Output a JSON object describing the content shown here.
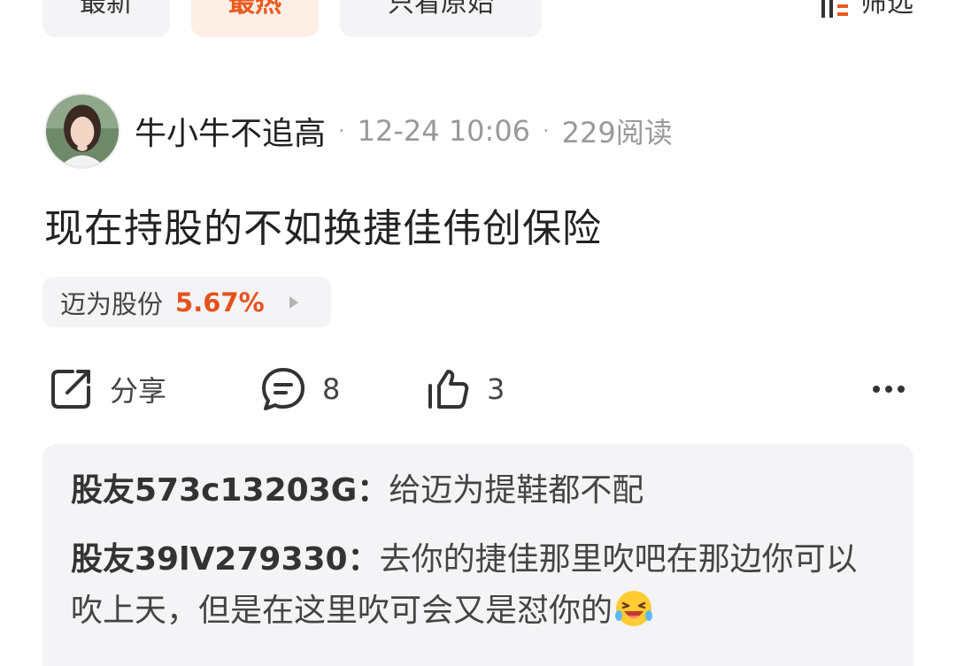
{
  "tabs": {
    "latest": "最新",
    "hot": "最热",
    "original_only": "只看原始",
    "filter": "筛选"
  },
  "post": {
    "author": "牛小牛不追高",
    "time": "12-24 10:06",
    "views": "229阅读",
    "content": "现在持股的不如换捷佳伟创保险",
    "stock": {
      "name": "迈为股份",
      "change": "5.67%"
    }
  },
  "actions": {
    "share_label": "分享",
    "comment_count": "8",
    "like_count": "3"
  },
  "comments": [
    {
      "user": "股友573c13203G",
      "text": "给迈为提鞋都不配"
    },
    {
      "user": "股友39lV279330",
      "text": "去你的捷佳那里吹吧在那边你可以吹上天，但是在这里吹可会又是怼你的"
    }
  ],
  "comments_more": "...",
  "colors": {
    "accent": "#ea5a1d",
    "stock_up": "#e5521c",
    "muted": "#999999",
    "panel": "#f4f4f6"
  },
  "icons": {
    "share": "share-icon",
    "comment": "comment-icon",
    "like": "thumbs-up-icon",
    "more": "more-dots-icon",
    "filter": "filter-icon"
  }
}
